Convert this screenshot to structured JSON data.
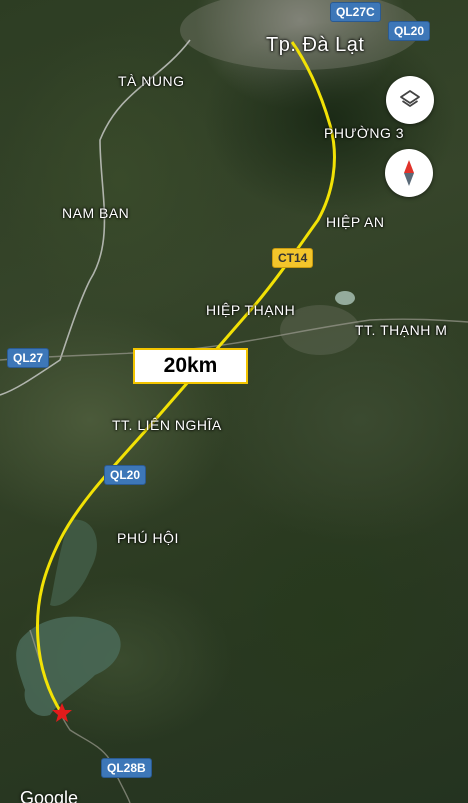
{
  "places": {
    "da_lat": "Tp. Đà Lạt",
    "ta_nung": "TÀ NUNG",
    "phuong_3": "PHƯỜNG 3",
    "nam_ban": "NAM BAN",
    "hiep_an": "HIỆP AN",
    "hiep_thanh": "HIỆP THẠNH",
    "thanh_my": "TT. THẠNH M",
    "lien_nghia": "TT. LIÊN NGHĨA",
    "phu_hoi": "PHÚ HỘI"
  },
  "roads": {
    "ql27c": "QL27C",
    "ql20_top": "QL20",
    "ct14": "CT14",
    "ql27": "QL27",
    "ql20_mid": "QL20",
    "ql28b": "QL28B"
  },
  "route": {
    "distance_label": "20km",
    "line_color": "#f2e205",
    "destination_marker_color": "#e31b1b"
  },
  "controls": {
    "layers_icon": "layers-icon",
    "compass_icon": "compass-icon"
  },
  "attribution": "Google"
}
